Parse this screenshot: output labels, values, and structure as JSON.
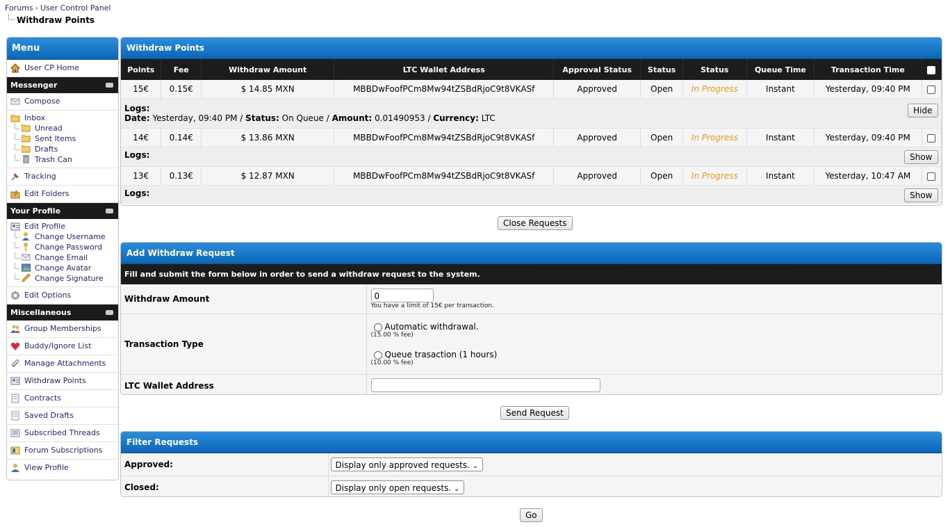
{
  "breadcrumb": {
    "items": [
      "Forums",
      "User Control Panel"
    ],
    "separator": "›",
    "current": "Withdraw Points"
  },
  "sidebar": {
    "title": "Menu",
    "home": "User CP Home",
    "messenger": {
      "title": "Messenger",
      "compose": "Compose",
      "inbox": "Inbox",
      "folders": [
        "Unread",
        "Sent Items",
        "Drafts",
        "Trash Can"
      ],
      "tracking": "Tracking",
      "edit_folders": "Edit Folders"
    },
    "profile": {
      "title": "Your Profile",
      "edit_profile": "Edit Profile",
      "sub": [
        "Change Username",
        "Change Password",
        "Change Email",
        "Change Avatar",
        "Change Signature"
      ],
      "edit_options": "Edit Options"
    },
    "misc": {
      "title": "Miscellaneous",
      "items": [
        "Group Memberships",
        "Buddy/Ignore List",
        "Manage Attachments",
        "Withdraw Points",
        "Contracts",
        "Saved Drafts",
        "Subscribed Threads",
        "Forum Subscriptions",
        "View Profile"
      ]
    }
  },
  "withdraw": {
    "title": "Withdraw Points",
    "columns": [
      "Points",
      "Fee",
      "Withdraw Amount",
      "LTC Wallet Address",
      "Approval Status",
      "Status",
      "Status",
      "Queue Time",
      "Transaction Time"
    ],
    "rows": [
      {
        "points": "15€",
        "fee": "0.15€",
        "amount": "$ 14.85 MXN",
        "wallet": "MBBDwFoofPCm8Mw94tZSBdRjoC9t8VKASf",
        "approval": "Approved",
        "status": "Open",
        "progress": "In Progress",
        "queue": "Instant",
        "time": "Yesterday, 09:40 PM"
      },
      {
        "points": "14€",
        "fee": "0.14€",
        "amount": "$ 13.86 MXN",
        "wallet": "MBBDwFoofPCm8Mw94tZSBdRjoC9t8VKASf",
        "approval": "Approved",
        "status": "Open",
        "progress": "In Progress",
        "queue": "Instant",
        "time": "Yesterday, 09:40 PM"
      },
      {
        "points": "13€",
        "fee": "0.13€",
        "amount": "$ 12.87 MXN",
        "wallet": "MBBDwFoofPCm8Mw94tZSBdRjoC9t8VKASf",
        "approval": "Approved",
        "status": "Open",
        "progress": "In Progress",
        "queue": "Instant",
        "time": "Yesterday, 10:47 AM"
      }
    ],
    "logs_label": "Logs:",
    "log_detail": {
      "date_label": "Date:",
      "date": "Yesterday, 09:40 PM",
      "status_label": "Status:",
      "status": "On Queue",
      "amount_label": "Amount:",
      "amount": "0.01490953",
      "currency_label": "Currency:",
      "currency": "LTC"
    },
    "hide_label": "Hide",
    "show_label": "Show",
    "close_requests": "Close Requests"
  },
  "add_request": {
    "title": "Add Withdraw Request",
    "instructions": "Fill and submit the form below in order to send a withdraw request to the system.",
    "amount_label": "Withdraw Amount",
    "amount_value": "0",
    "amount_hint": "You have a limit of 15€ per transaction.",
    "type_label": "Transaction Type",
    "option_auto": "Automatic withdrawal.",
    "option_auto_fee": "(15.00 % fee)",
    "option_queue": "Queue trasaction (1 hours)",
    "option_queue_fee": "(10.00 % fee)",
    "wallet_label": "LTC Wallet Address",
    "wallet_value": "",
    "send": "Send Request"
  },
  "filter": {
    "title": "Filter Requests",
    "approved_label": "Approved:",
    "approved_value": "Display only approved requests.",
    "closed_label": "Closed:",
    "closed_value": "Display only open requests.",
    "go": "Go"
  },
  "colors": {
    "header_blue": "#0b66b8",
    "dark_bar": "#1c1c1c",
    "in_progress": "#f29a1b",
    "link": "#22229c"
  }
}
